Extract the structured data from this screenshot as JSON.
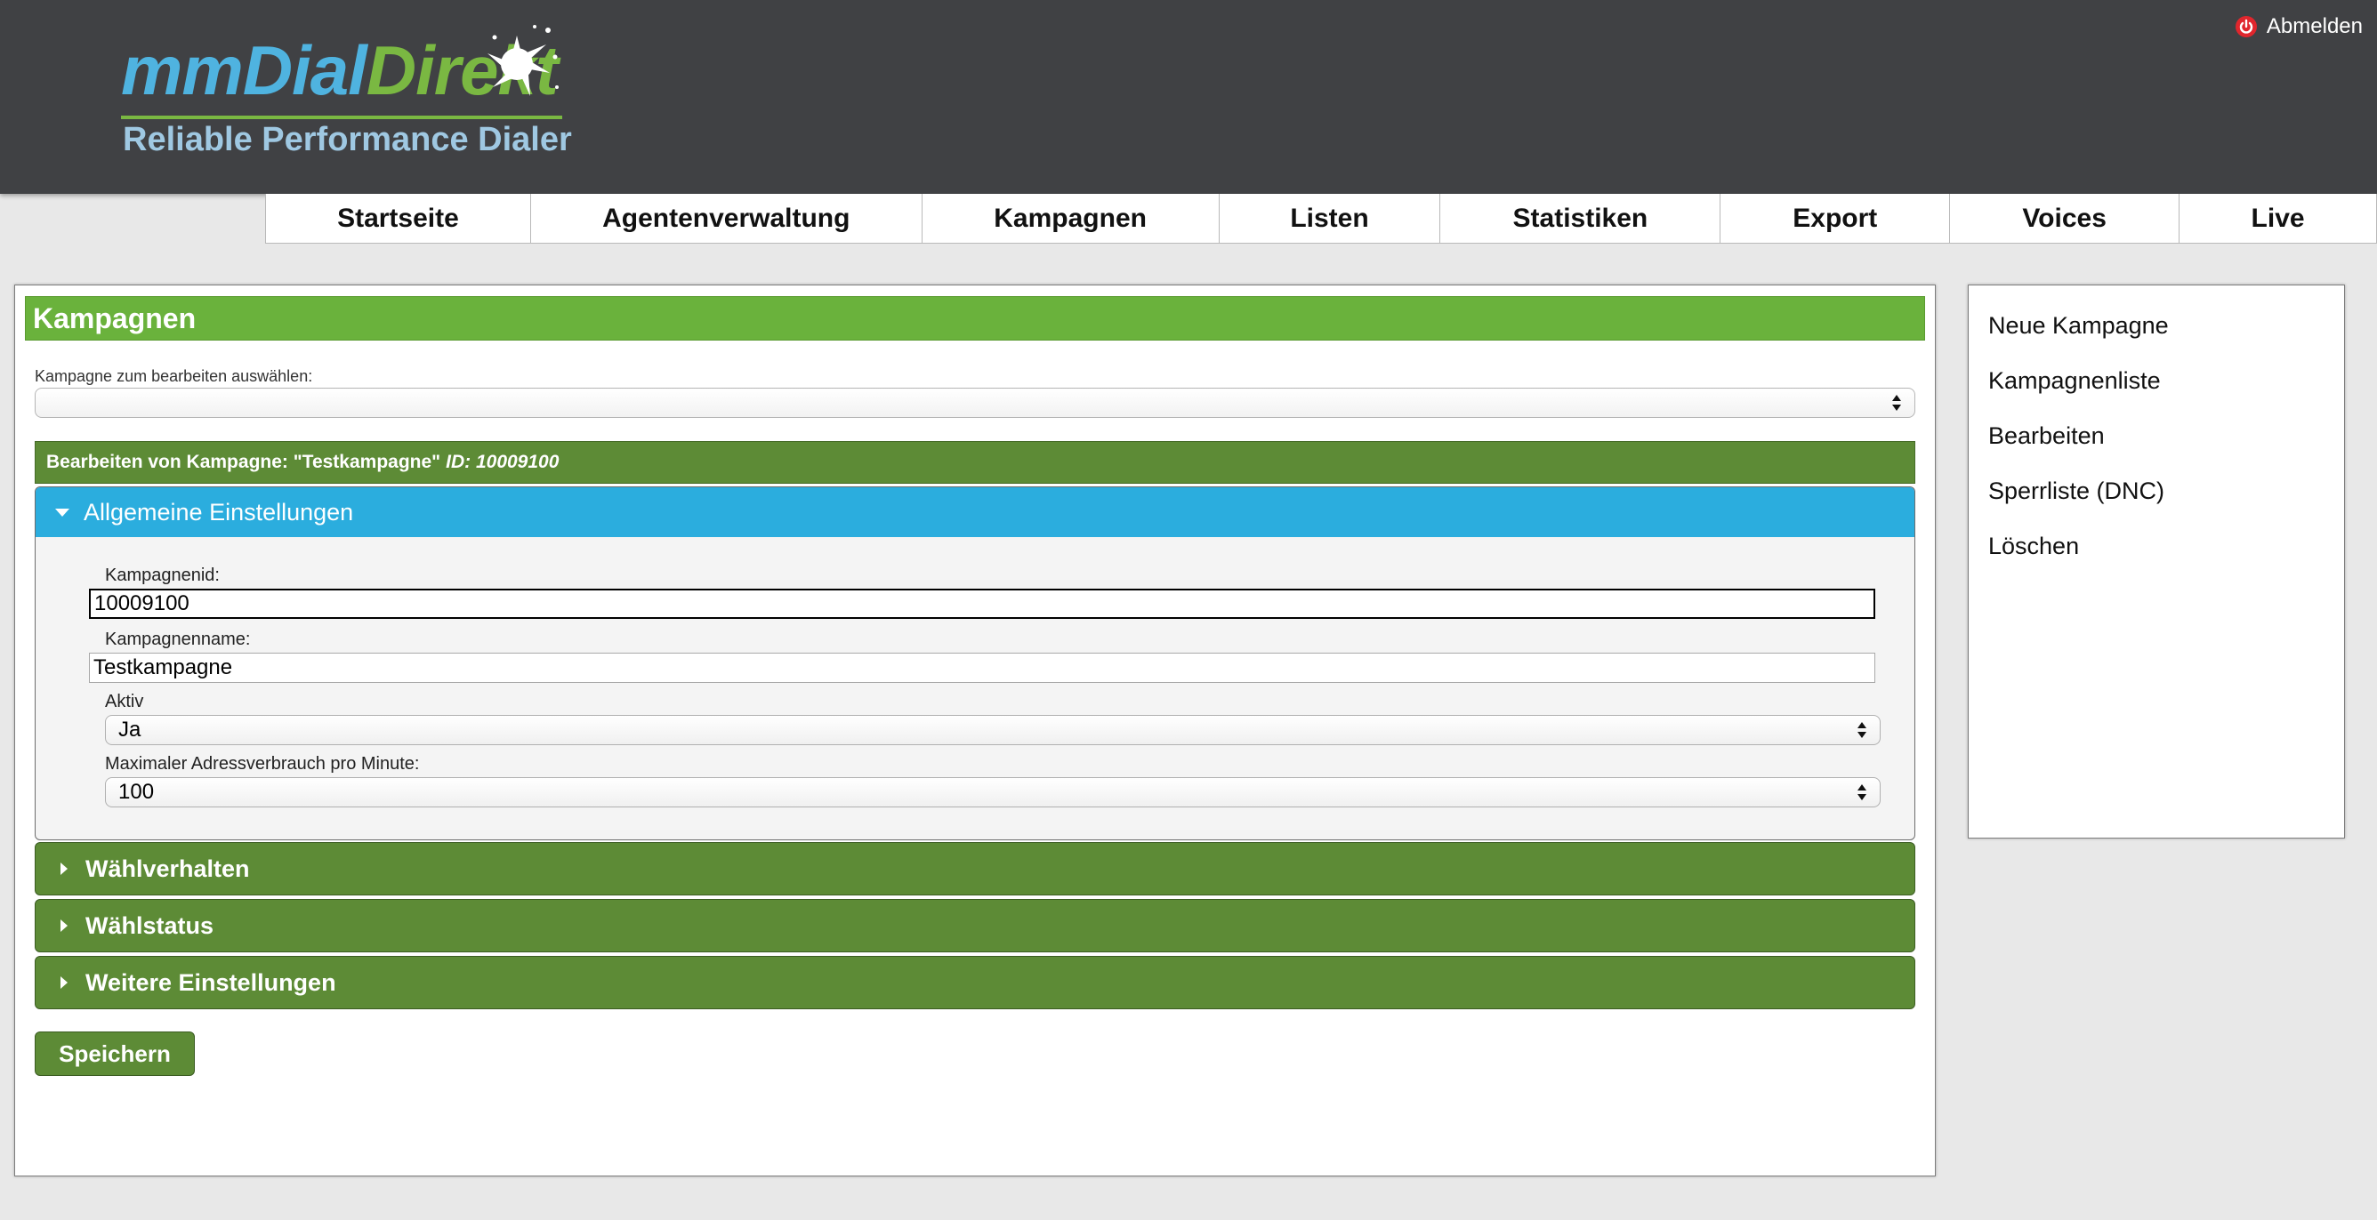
{
  "header": {
    "logo_main_part1": "mmDial",
    "logo_main_part2": "Direkt",
    "logo_subtitle": "Reliable Performance Dialer",
    "logout_label": "Abmelden",
    "logout_icon": "power-icon",
    "logout_icon_color": "#e0262d"
  },
  "nav": {
    "items": [
      {
        "label": "Startseite"
      },
      {
        "label": "Agentenverwaltung"
      },
      {
        "label": "Kampagnen"
      },
      {
        "label": "Listen"
      },
      {
        "label": "Statistiken"
      },
      {
        "label": "Export"
      },
      {
        "label": "Voices"
      },
      {
        "label": "Live"
      }
    ]
  },
  "main": {
    "title": "Kampagnen",
    "select_label": "Kampagne zum bearbeiten auswählen:",
    "select_value": "",
    "edit_header": "Bearbeiten von Kampagne: \"Testkampagne\"",
    "edit_id": "ID: 10009100",
    "sections": {
      "general": {
        "title": "Allgemeine Einstellungen",
        "kampagnenid_label": "Kampagnenid:",
        "kampagnenid_value": "10009100",
        "kampagnenname_label": "Kampagnenname:",
        "kampagnenname_value": "Testkampagne",
        "aktiv_label": "Aktiv",
        "aktiv_value": "Ja",
        "max_label": "Maximaler Adressverbrauch pro Minute:",
        "max_value": "100"
      },
      "collapsed": [
        {
          "title": "Wählverhalten"
        },
        {
          "title": "Wählstatus"
        },
        {
          "title": "Weitere Einstellungen"
        }
      ]
    },
    "save_label": "Speichern"
  },
  "side_menu": {
    "items": [
      {
        "label": "Neue Kampagne"
      },
      {
        "label": "Kampagnenliste"
      },
      {
        "label": "Bearbeiten"
      },
      {
        "label": "Sperrliste (DNC)"
      },
      {
        "label": "Löschen"
      }
    ]
  },
  "colors": {
    "header_bg": "#404144",
    "title_green": "#6ab23c",
    "dark_green": "#5d8b36",
    "accordion_blue": "#2badde"
  }
}
